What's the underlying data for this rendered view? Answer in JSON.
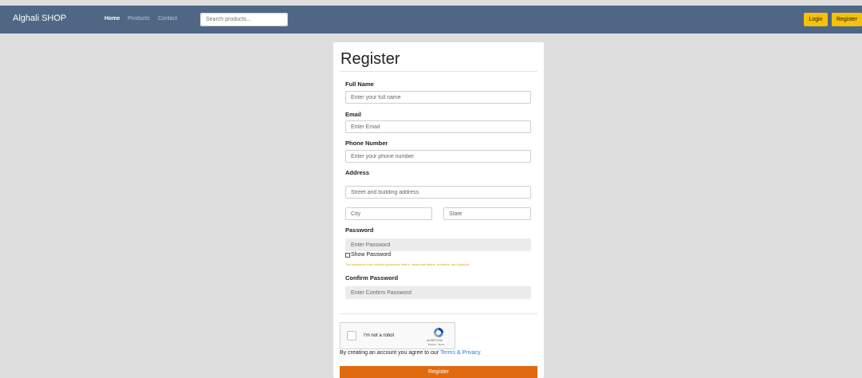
{
  "header": {
    "brand": "Alghali SHOP",
    "nav": {
      "home": "Home",
      "products": "Products",
      "contact": "Contact"
    },
    "search_placeholder": "Search products...",
    "login_label": "Login",
    "register_label": "Register"
  },
  "form": {
    "title": "Register",
    "full_name": {
      "label": "Full Name",
      "placeholder": "Enter your full name"
    },
    "email": {
      "label": "Email",
      "placeholder": "Enter Email"
    },
    "phone": {
      "label": "Phone Number",
      "placeholder": "Enter your phone number"
    },
    "address": {
      "label": "Address",
      "street_placeholder": "Street and building address",
      "city_placeholder": "City",
      "state_placeholder": "State"
    },
    "password": {
      "label": "Password",
      "placeholder": "Enter Password",
      "show_label": "Show Password",
      "hint": "The password must contain uppercase letters, lowercase letters, numbers, and symbols"
    },
    "confirm_password": {
      "label": "Confirm Password",
      "placeholder": "Enter Confirm Password"
    },
    "captcha": {
      "text": "I'm not a robot",
      "brand": "reCAPTCHA",
      "links": "Privacy - Terms"
    },
    "terms_prefix": "By creating an account you agree to our ",
    "terms_link": "Terms & Privacy.",
    "submit_label": "Register"
  },
  "colors": {
    "navbar": "#4f6785",
    "accent_yellow": "#f5c10a",
    "submit_orange": "#e06a10",
    "link_blue": "#2d7be0",
    "hint_orange": "#e0a41a"
  }
}
